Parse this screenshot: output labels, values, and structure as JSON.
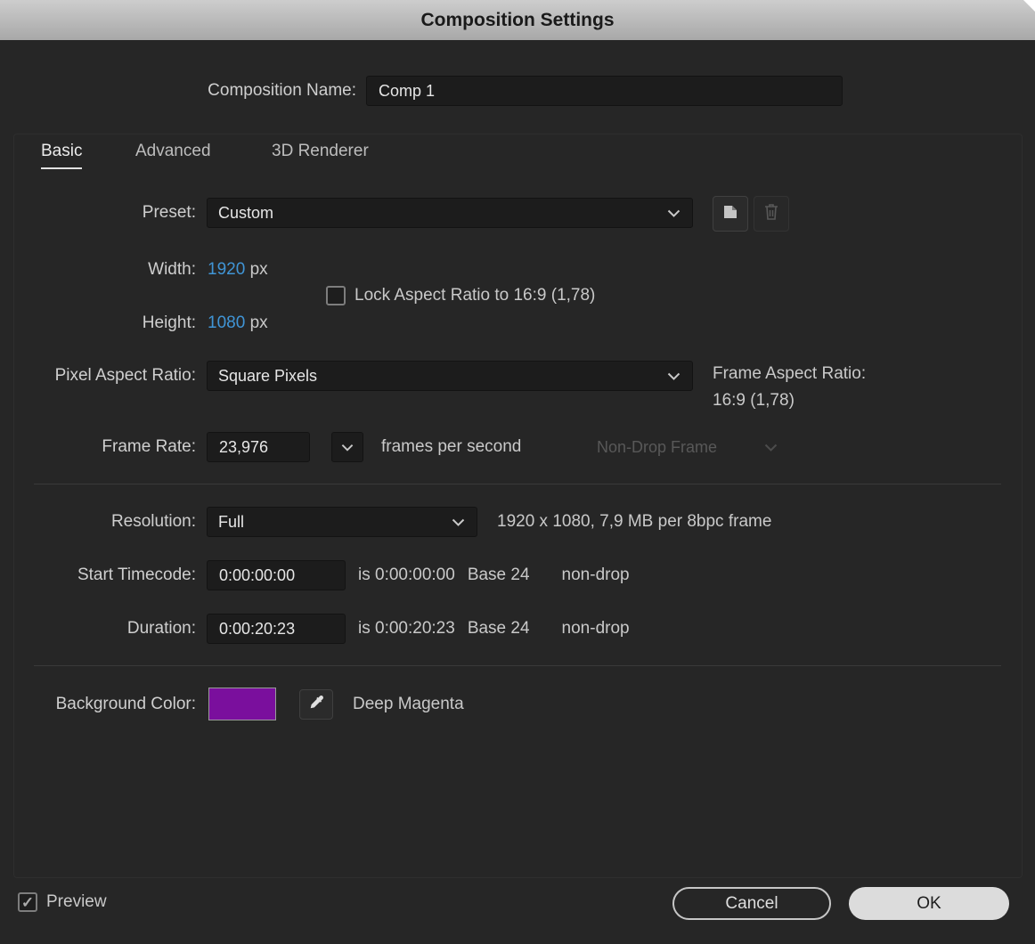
{
  "dialog": {
    "title": "Composition Settings",
    "name_label": "Composition Name:",
    "name_value": "Comp 1"
  },
  "tabs": [
    {
      "label": "Basic",
      "active": true
    },
    {
      "label": "Advanced",
      "active": false
    },
    {
      "label": "3D Renderer",
      "active": false
    }
  ],
  "basic": {
    "preset": {
      "label": "Preset:",
      "value": "Custom"
    },
    "width": {
      "label": "Width:",
      "value": "1920",
      "unit": "px"
    },
    "lock_aspect": {
      "label": "Lock Aspect Ratio to 16:9 (1,78)",
      "checked": false
    },
    "height": {
      "label": "Height:",
      "value": "1080",
      "unit": "px"
    },
    "pixel_aspect_ratio": {
      "label": "Pixel Aspect Ratio:",
      "value": "Square Pixels"
    },
    "frame_aspect_ratio": {
      "label": "Frame Aspect Ratio:",
      "value": "16:9 (1,78)"
    },
    "frame_rate": {
      "label": "Frame Rate:",
      "value": "23,976",
      "suffix": "frames per second",
      "drop_frame": "Non-Drop Frame"
    },
    "resolution": {
      "label": "Resolution:",
      "value": "Full",
      "info": "1920 x 1080, 7,9 MB per 8bpc frame"
    },
    "start_timecode": {
      "label": "Start Timecode:",
      "value": "0:00:00:00",
      "info_is": "is 0:00:00:00",
      "info_base": "Base 24",
      "info_drop": "non-drop"
    },
    "duration": {
      "label": "Duration:",
      "value": "0:00:20:23",
      "info_is": "is 0:00:20:23",
      "info_base": "Base 24",
      "info_drop": "non-drop"
    },
    "background_color": {
      "label": "Background Color:",
      "color": "#7a0f9d",
      "color_name": "Deep Magenta"
    }
  },
  "footer": {
    "preview_label": "Preview",
    "preview_checked": true,
    "preview_check_glyph": "✓",
    "cancel_label": "Cancel",
    "ok_label": "OK"
  },
  "colors": {
    "accent_blue": "#4095d6",
    "swatch_purple": "#7a0f9d",
    "titlebar_gray": "#b8b8b8"
  }
}
